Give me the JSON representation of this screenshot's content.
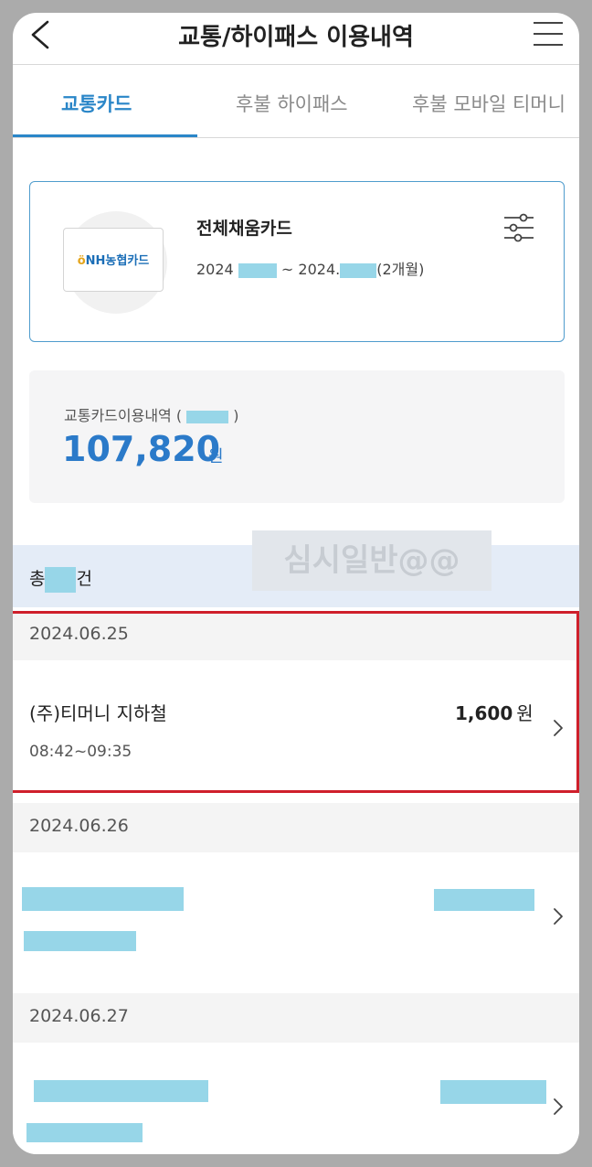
{
  "header": {
    "title": "교통/하이패스 이용내역",
    "back_icon": "chevron-left-icon",
    "menu_icon": "hamburger-menu-icon"
  },
  "tabs": [
    {
      "label": "교통카드",
      "active": true
    },
    {
      "label": "후불 하이패스",
      "active": false
    },
    {
      "label": "후불 모바일 티머니",
      "active": false
    }
  ],
  "card": {
    "logo_text": "NH농협카드",
    "name": "전체채움카드",
    "period_start": "2024",
    "period_mid": "~ 2024.",
    "period_suffix": "(2개월)",
    "filter_icon": "sliders-filter-icon"
  },
  "summary": {
    "label_prefix": "교통카드이용내역 (",
    "label_suffix": ")",
    "amount": "107,820",
    "unit": "원"
  },
  "watermark": "심시일반@@",
  "count": {
    "prefix": "총",
    "suffix": "건"
  },
  "groups": [
    {
      "date": "2024.06.25",
      "items": [
        {
          "title": "(주)티머니 지하철",
          "time": "08:42~09:35",
          "amount": "1,600",
          "unit": "원"
        }
      ]
    },
    {
      "date": "2024.06.26",
      "items": []
    },
    {
      "date": "2024.06.27",
      "items": []
    }
  ],
  "colors": {
    "accent": "#2a86c8",
    "amount_blue": "#2b7ac9",
    "highlight_red": "#cf1f2b",
    "redaction": "#97d6e8"
  }
}
